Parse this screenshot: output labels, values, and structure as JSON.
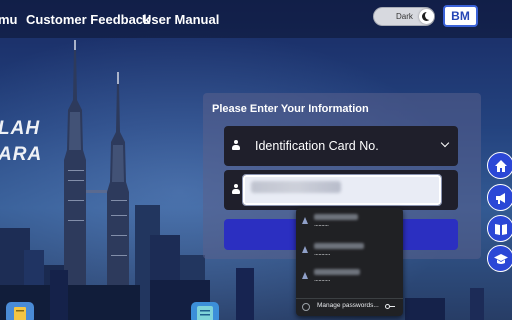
{
  "nav": {
    "items": [
      "mu",
      "Customer Feedback",
      "User Manual"
    ]
  },
  "theme_toggle": {
    "label": "Dark"
  },
  "language_button": {
    "label": "BM"
  },
  "hero": {
    "line1": "LAH",
    "line2": "ARA"
  },
  "form": {
    "title": "Please Enter Your Information",
    "id_type": {
      "value": "Identification Card No."
    },
    "id_number": {
      "value": ""
    }
  },
  "autofill": {
    "entries": [
      {
        "password_mask": ".........."
      },
      {
        "password_mask": "..........."
      },
      {
        "password_mask": "..........."
      }
    ],
    "manage_label": "Manage passwords..."
  },
  "side_nav": {
    "icons": [
      "home-icon",
      "announcement-icon",
      "manual-book-icon",
      "graduation-cap-icon"
    ]
  },
  "colors": {
    "primary_blue": "#2b2fc1",
    "side_button_blue": "#2b47d6",
    "lang_button_border": "#3a62d8"
  }
}
